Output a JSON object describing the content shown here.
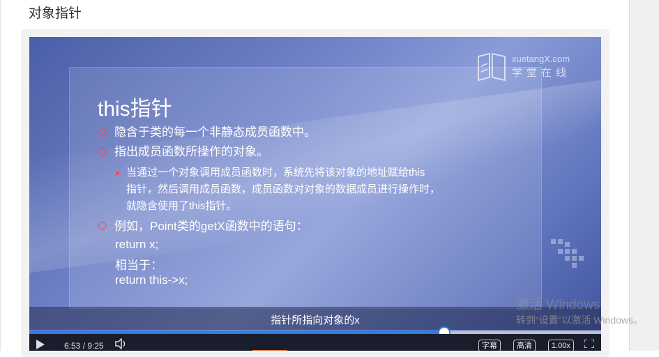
{
  "page": {
    "title": "对象指针"
  },
  "slide": {
    "logo_en": "xuetangX.com",
    "logo_cn": "学堂在线",
    "title": "this指针",
    "bullets": [
      "隐含于类的每一个非静态成员函数中。",
      "指出成员函数所操作的对象。"
    ],
    "sub_lines": [
      "当通过一个对象调用成员函数时，系统先将该对象的地址赋给this",
      "指针，然后调用成员函数，成员函数对对象的数据成员进行操作时，",
      "就隐含使用了this指针。"
    ],
    "example": "例如，Point类的getX函数中的语句：",
    "code": [
      "return x;",
      "相当于：",
      "return this->x;"
    ]
  },
  "player": {
    "subtitle": "指针所指向对象的x",
    "time": "6:53 / 9:25",
    "progress": 0.726,
    "caption_label": "字幕",
    "quality_label": "高清",
    "speed_label": "1.00x"
  },
  "watermark": {
    "line1": "激活 Windows",
    "line2": "转到“设置”以激活 Windows。"
  },
  "colors": {
    "accent": "#2f7de1",
    "bullet": "#e0506a"
  }
}
